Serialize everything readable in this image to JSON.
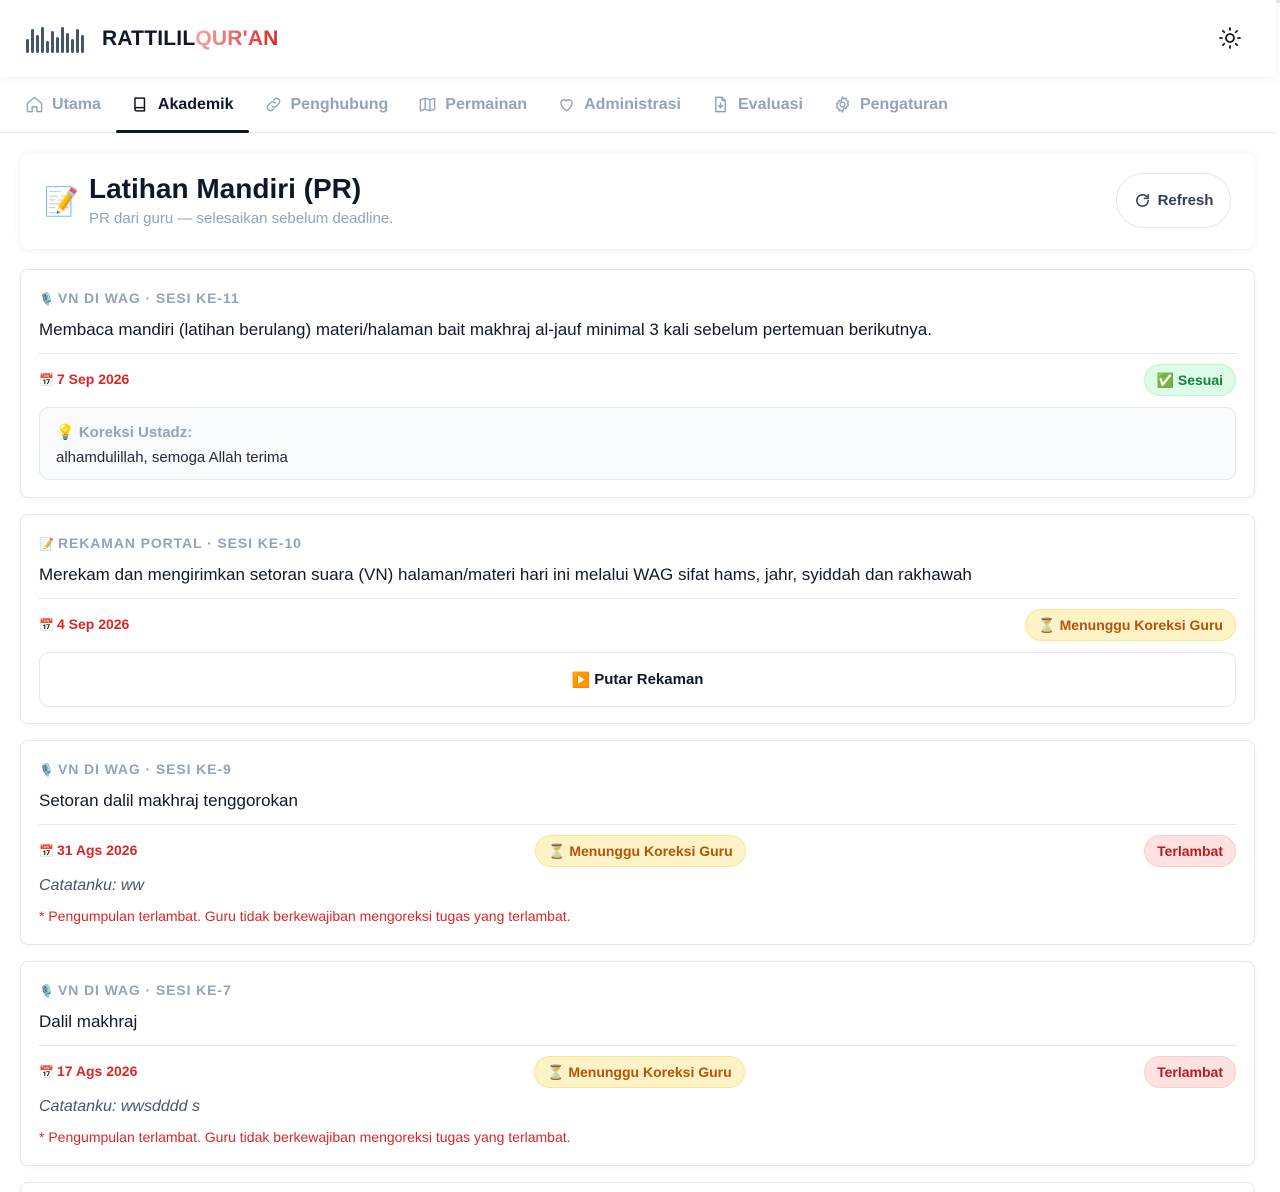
{
  "app": {
    "brand_part1": "RATTILIL",
    "brand_part2": "QUR'AN",
    "accent_color": "#dc2626"
  },
  "nav": {
    "tabs": [
      {
        "label": "Utama",
        "icon": "home-icon"
      },
      {
        "label": "Akademik",
        "icon": "book-icon"
      },
      {
        "label": "Penghubung",
        "icon": "link-icon"
      },
      {
        "label": "Permainan",
        "icon": "map-icon"
      },
      {
        "label": "Administrasi",
        "icon": "heart-icon"
      },
      {
        "label": "Evaluasi",
        "icon": "file-download-icon"
      },
      {
        "label": "Pengaturan",
        "icon": "gear-icon"
      }
    ],
    "active": "Akademik"
  },
  "page": {
    "icon": "📝",
    "title": "Latihan Mandiri (PR)",
    "subtitle": "PR dari guru — selesaikan sebelum deadline.",
    "refresh_label": "Refresh"
  },
  "tasks": [
    {
      "emoji": "🎙️",
      "meta": "VN DI WAG · SESI KE-11",
      "title": "Membaca mandiri (latihan berulang) materi/halaman bait makhraj al-jauf minimal 3 kali sebelum pertemuan berikutnya.",
      "due_emoji": "📅",
      "due": "7 Sep 2026",
      "status": "✅ Sesuai",
      "correction_label": "💡 Koreksi Ustadz:",
      "correction_text": "alhamdulillah, semoga Allah terima"
    },
    {
      "emoji": "📝",
      "meta": "REKAMAN PORTAL · SESI KE-10",
      "title": "Merekam dan mengirimkan setoran suara (VN) halaman/materi hari ini melalui WAG sifat hams, jahr, syiddah dan rakhawah",
      "due_emoji": "📅",
      "due": "4 Sep 2026",
      "status": "⏳ Menunggu Koreksi Guru",
      "play_emoji": "▶️",
      "play_label": "Putar Rekaman"
    },
    {
      "emoji": "🎙️",
      "meta": "VN DI WAG · SESI KE-9",
      "title": "Setoran dalil makhraj tenggorokan",
      "due_emoji": "📅",
      "due": "31 Ags 2026",
      "status": "⏳ Menunggu Koreksi Guru",
      "late_badge": "Terlambat",
      "note": "Catatanku: ww",
      "warning": "* Pengumpulan terlambat. Guru tidak berkewajiban mengoreksi tugas yang terlambat."
    },
    {
      "emoji": "🎙️",
      "meta": "VN DI WAG · SESI KE-7",
      "title": "Dalil makhraj",
      "due_emoji": "📅",
      "due": "17 Ags 2026",
      "status": "⏳ Menunggu Koreksi Guru",
      "late_badge": "Terlambat",
      "note": "Catatanku: wwsdddd s",
      "warning": "* Pengumpulan terlambat. Guru tidak berkewajiban mengoreksi tugas yang terlambat."
    }
  ]
}
